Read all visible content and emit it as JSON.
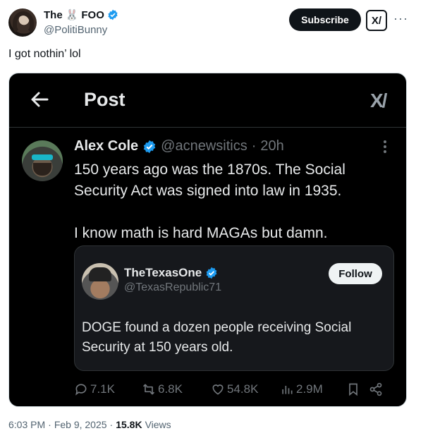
{
  "author": {
    "name_prefix": "The",
    "name_emoji": "🐰",
    "name_suffix": "FOO",
    "handle": "@PolitiBunny"
  },
  "header": {
    "subscribe_label": "Subscribe",
    "grok_label": "X/",
    "more": "···"
  },
  "tweet": {
    "text": "I got nothin’ lol"
  },
  "screenshot": {
    "title": "Post",
    "grok_label": "X/",
    "post": {
      "name": "Alex Cole",
      "handle": "@acnewsitics",
      "time": "20h",
      "separator": "·",
      "text_1": "150 years ago was the 1870s. The Social Security Act was signed into law in 1935.",
      "text_2": "I know math is hard MAGAs but damn."
    },
    "quote": {
      "name": "TheTexasOne",
      "handle": "@TexasRepublic71",
      "follow_label": "Follow",
      "text": "DOGE found a dozen people receiving Social Security at 150 years old."
    },
    "actions": {
      "replies": "7.1K",
      "reposts": "6.8K",
      "likes": "54.8K",
      "views": "2.9M"
    }
  },
  "footer": {
    "time": "6:03 PM",
    "separator": "·",
    "date": "Feb 9, 2025",
    "separator2": "·",
    "views_count": "15.8K",
    "views_label": "Views"
  },
  "colors": {
    "verified": "#1d9bf0",
    "dark_bg": "#000000",
    "quote_bg": "#16181c"
  }
}
